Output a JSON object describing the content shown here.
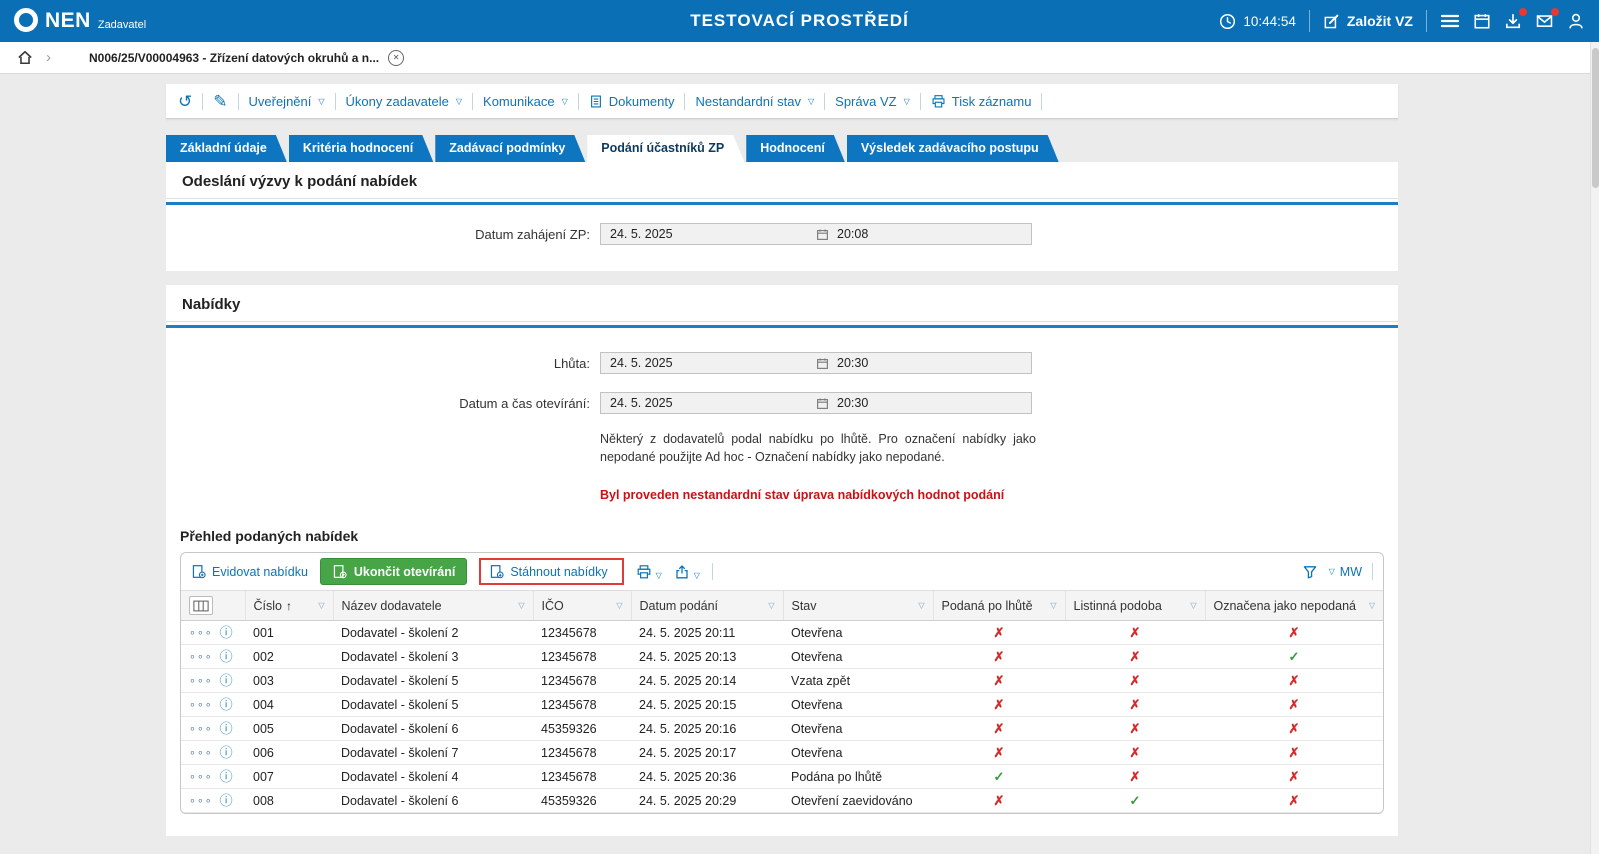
{
  "header": {
    "logo": "NEN",
    "role": "Zadavatel",
    "env_title": "TESTOVACÍ PROSTŘEDÍ",
    "time": "10:44:54",
    "new_vz_label": "Založit VZ"
  },
  "breadcrumb": {
    "record_tab": "N006/25/V00004963 - Zřízení datových okruhů a n..."
  },
  "toolbar": {
    "items": [
      {
        "label": "Uveřejnění"
      },
      {
        "label": "Úkony zadavatele"
      },
      {
        "label": "Komunikace"
      },
      {
        "label": "Dokumenty"
      },
      {
        "label": "Nestandardní stav"
      },
      {
        "label": "Správa VZ"
      },
      {
        "label": "Tisk záznamu"
      }
    ]
  },
  "tabs": [
    {
      "label": "Základní údaje",
      "active": false
    },
    {
      "label": "Kritéria hodnocení",
      "active": false
    },
    {
      "label": "Zadávací podmínky",
      "active": false
    },
    {
      "label": "Podání účastníků ZP",
      "active": true
    },
    {
      "label": "Hodnocení",
      "active": false
    },
    {
      "label": "Výsledek zadávacího postupu",
      "active": false
    }
  ],
  "invite_section": {
    "title": "Odeslání výzvy k podání nabídek",
    "field_label": "Datum zahájení ZP:",
    "date": "24. 5. 2025",
    "time": "20:08"
  },
  "offers_section": {
    "title": "Nabídky",
    "deadline_label": "Lhůta:",
    "deadline_date": "24. 5. 2025",
    "deadline_time": "20:30",
    "opening_label": "Datum a čas otevírání:",
    "opening_date": "24. 5. 2025",
    "opening_time": "20:30",
    "info_text": "Některý z dodavatelů podal nabídku po lhůtě. Pro označení nabídky jako nepodané použijte Ad hoc - Označení nabídky jako nepodané.",
    "warning_text": "Byl proveden nestandardní stav úprava nabídkových hodnot podání"
  },
  "offers_table": {
    "title": "Přehled podaných nabídek",
    "toolbar": {
      "register_label": "Evidovat nabídku",
      "finish_label": "Ukončit otevírání",
      "download_label": "Stáhnout nabídky",
      "mw_label": "MW"
    },
    "columns": [
      "Číslo",
      "Název dodavatele",
      "IČO",
      "Datum podání",
      "Stav",
      "Podaná po lhůtě",
      "Listinná podoba",
      "Označena jako nepodaná"
    ],
    "rows": [
      {
        "num": "001",
        "supplier": "Dodavatel - školení 2",
        "ico": "12345678",
        "submitted": "24. 5. 2025 20:11",
        "status": "Otevřena",
        "late": false,
        "paper": false,
        "marked_not_submitted": false
      },
      {
        "num": "002",
        "supplier": "Dodavatel - školení 3",
        "ico": "12345678",
        "submitted": "24. 5. 2025 20:13",
        "status": "Otevřena",
        "late": false,
        "paper": false,
        "marked_not_submitted": true
      },
      {
        "num": "003",
        "supplier": "Dodavatel - školení 5",
        "ico": "12345678",
        "submitted": "24. 5. 2025 20:14",
        "status": "Vzata zpět",
        "late": false,
        "paper": false,
        "marked_not_submitted": false
      },
      {
        "num": "004",
        "supplier": "Dodavatel - školení 5",
        "ico": "12345678",
        "submitted": "24. 5. 2025 20:15",
        "status": "Otevřena",
        "late": false,
        "paper": false,
        "marked_not_submitted": false
      },
      {
        "num": "005",
        "supplier": "Dodavatel - školení 6",
        "ico": "45359326",
        "submitted": "24. 5. 2025 20:16",
        "status": "Otevřena",
        "late": false,
        "paper": false,
        "marked_not_submitted": false
      },
      {
        "num": "006",
        "supplier": "Dodavatel - školení 7",
        "ico": "12345678",
        "submitted": "24. 5. 2025 20:17",
        "status": "Otevřena",
        "late": false,
        "paper": false,
        "marked_not_submitted": false
      },
      {
        "num": "007",
        "supplier": "Dodavatel - školení 4",
        "ico": "12345678",
        "submitted": "24. 5. 2025 20:36",
        "status": "Podána po lhůtě",
        "late": true,
        "paper": false,
        "marked_not_submitted": false
      },
      {
        "num": "008",
        "supplier": "Dodavatel - školení 6",
        "ico": "45359326",
        "submitted": "24. 5. 2025 20:29",
        "status": "Otevření zaevidováno",
        "late": false,
        "paper": true,
        "marked_not_submitted": false
      }
    ]
  },
  "icons": {
    "chevron": "›",
    "close": "✕",
    "history": "↺",
    "edit": "✎",
    "dropdown": "▽",
    "sort_asc": "↑",
    "row_menu": "∘∘∘",
    "row_info": "ⓘ",
    "check_yes": "✓",
    "check_no": "✗"
  },
  "colors": {
    "header_blue": "#0a6fb4",
    "link_blue": "#0d74b5",
    "tab_blue": "#0e76c0",
    "green_button": "#47a447",
    "warning_red": "#cc1111",
    "check_green": "#3a9a3a",
    "cross_red": "#d42a2a",
    "highlight_red": "#e03a3a"
  }
}
